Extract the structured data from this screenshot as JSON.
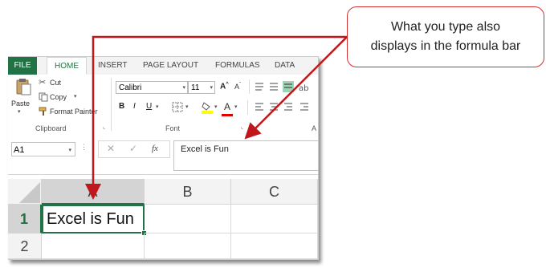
{
  "callout": {
    "line1": "What you type also",
    "line2": "displays in the formula bar"
  },
  "ribbon_tabs": {
    "file": "FILE",
    "home": "HOME",
    "insert": "INSERT",
    "page_layout": "PAGE LAYOUT",
    "formulas": "FORMULAS",
    "data": "DATA"
  },
  "clipboard": {
    "paste": "Paste",
    "cut": "Cut",
    "copy": "Copy",
    "format_painter": "Format Painter",
    "group_label": "Clipboard"
  },
  "font": {
    "name": "Calibri",
    "size": "11",
    "group_label": "Font",
    "bold": "B",
    "italic": "I",
    "underline": "U",
    "cut_off_label": "A"
  },
  "formula_bar": {
    "name_box": "A1",
    "cancel": "✕",
    "enter": "✓",
    "fx": "fx",
    "content": "Excel is Fun"
  },
  "grid": {
    "columns": [
      "A",
      "B",
      "C"
    ],
    "rows": [
      "1",
      "2"
    ],
    "a1": "Excel is Fun"
  },
  "colors": {
    "excel_green": "#217346",
    "callout_red": "#d32f2f",
    "arrow_red": "#c0171d"
  }
}
